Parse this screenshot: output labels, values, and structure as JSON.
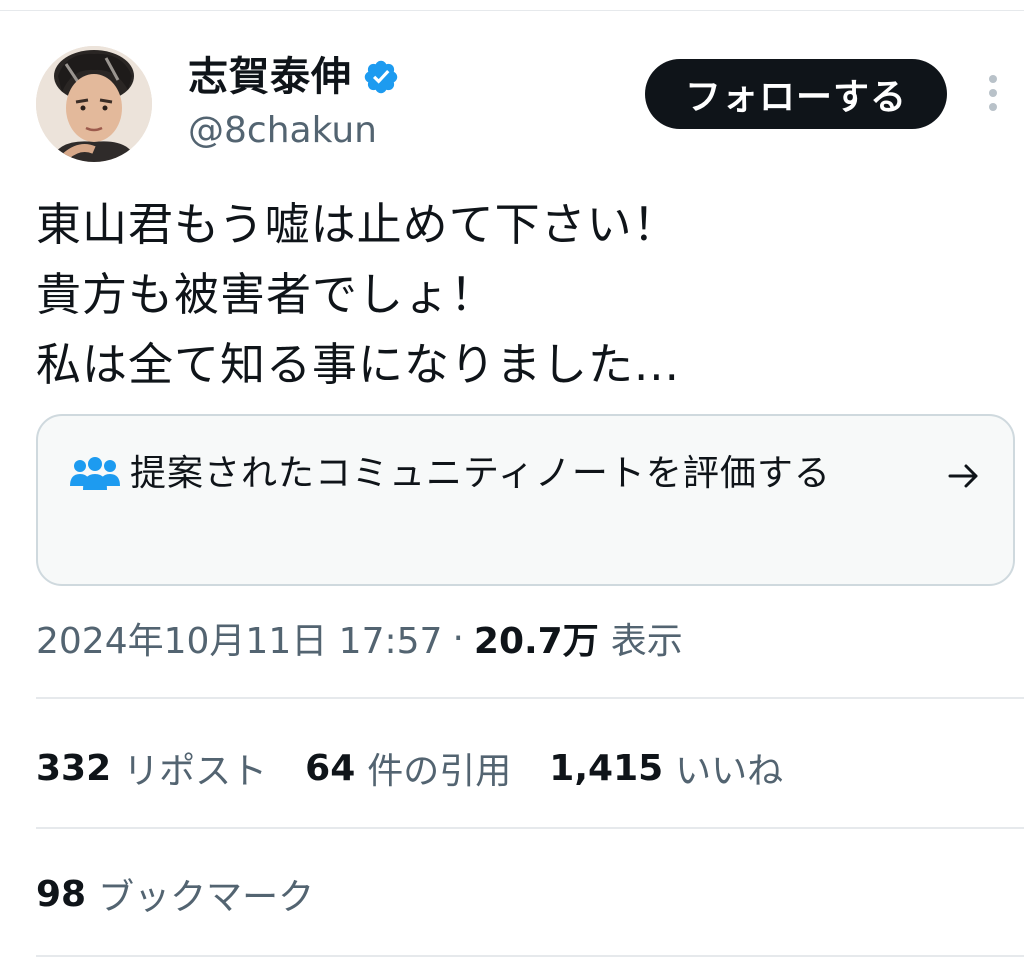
{
  "user": {
    "display_name": "志賀泰伸",
    "handle": "@8chakun",
    "verified": true,
    "verified_icon": "verified-badge-icon",
    "avatar_icon": "profile-avatar"
  },
  "actions": {
    "follow_label": "フォローする",
    "more_icon": "more-vertical-icon"
  },
  "tweet": {
    "lines": [
      "東山君もう嘘は止めて下さい！",
      "貴方も被害者でしょ！",
      "私は全て知る事になりました..."
    ]
  },
  "community_note": {
    "label": "提案されたコミュニティノートを評価する",
    "icon": "community-people-icon",
    "arrow_icon": "arrow-right-icon"
  },
  "meta": {
    "timestamp": "2024年10月11日 17:57",
    "separator": "·",
    "views_count": "20.7万",
    "views_label": "表示"
  },
  "stats": {
    "reposts": {
      "count": "332",
      "label": "リポスト"
    },
    "quotes": {
      "count": "64",
      "label": "件の引用"
    },
    "likes": {
      "count": "1,415",
      "label": "いいね"
    },
    "bookmarks": {
      "count": "98",
      "label": "ブックマーク"
    }
  },
  "colors": {
    "verified_blue": "#1d9bf0",
    "follow_bg": "#0f1419",
    "secondary_text": "#536471",
    "divider": "#e6e9ec"
  }
}
